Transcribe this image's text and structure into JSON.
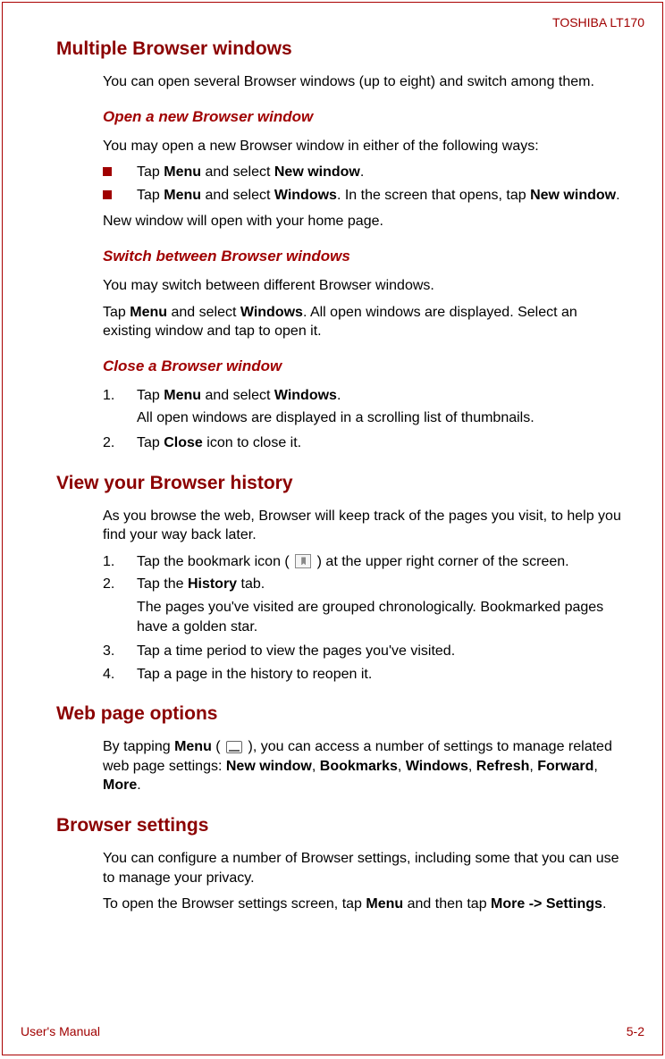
{
  "header": {
    "model": "TOSHIBA LT170"
  },
  "footer": {
    "left": "User's Manual",
    "right": "5-2"
  },
  "s1": {
    "title": "Multiple Browser windows",
    "intro": "You can open several Browser windows (up to eight) and switch among them.",
    "sub1": {
      "title": "Open a new Browser window",
      "p1": "You may open a new Browser window in either of the following ways:",
      "b1_pre": "Tap ",
      "b1_bold1": "Menu",
      "b1_mid": " and select ",
      "b1_bold2": "New window",
      "b1_post": ".",
      "b2_pre": "Tap ",
      "b2_bold1": "Menu",
      "b2_mid": " and select ",
      "b2_bold2": "Windows",
      "b2_mid2": ". In the screen that opens, tap ",
      "b2_bold3": "New window",
      "b2_post": ".",
      "p2": "New window will open with your home page."
    },
    "sub2": {
      "title": "Switch between Browser windows",
      "p1": "You may switch between different Browser windows.",
      "p2_pre": "Tap ",
      "p2_bold1": "Menu",
      "p2_mid": " and select ",
      "p2_bold2": "Windows",
      "p2_post": ". All open windows are displayed. Select an existing window and tap to open it."
    },
    "sub3": {
      "title": "Close a Browser window",
      "n1": "1.",
      "n1_pre": "Tap ",
      "n1_bold1": "Menu",
      "n1_mid": " and select ",
      "n1_bold2": "Windows",
      "n1_post": ".",
      "n1_sub": "All open windows are displayed in a scrolling list of thumbnails.",
      "n2": "2.",
      "n2_pre": "Tap ",
      "n2_bold1": "Close",
      "n2_post": " icon to close it."
    }
  },
  "s2": {
    "title": "View your Browser history",
    "intro": "As you browse the web, Browser will keep track of the pages you visit, to help you find your way back later.",
    "n1": "1.",
    "n1_pre": "Tap the bookmark icon ( ",
    "n1_post": " ) at the upper right corner of the screen.",
    "n2": "2.",
    "n2_pre": "Tap the ",
    "n2_bold1": "History",
    "n2_post": " tab.",
    "n2_sub": "The pages you've visited are grouped chronologically. Bookmarked pages have a golden star.",
    "n3": "3.",
    "n3_text": "Tap a time period to view the pages you've visited.",
    "n4": "4.",
    "n4_text": "Tap a page in the history to reopen it."
  },
  "s3": {
    "title": "Web page options",
    "p_pre": "By tapping ",
    "p_bold1": "Menu",
    "p_mid1": " ( ",
    "p_mid2": " ), you can access a number of settings to manage related web page settings: ",
    "p_bold2": "New window",
    "p_c1": ", ",
    "p_bold3": "Bookmarks",
    "p_c2": ", ",
    "p_bold4": "Windows",
    "p_c3": ", ",
    "p_bold5": "Refresh",
    "p_c4": ", ",
    "p_bold6": "Forward",
    "p_c5": ", ",
    "p_bold7": "More",
    "p_post": "."
  },
  "s4": {
    "title": "Browser settings",
    "p1": "You can configure a number of Browser settings, including some that you can use to manage your privacy.",
    "p2_pre": "To open the Browser settings screen, tap ",
    "p2_bold1": "Menu",
    "p2_mid": " and then tap ",
    "p2_bold2": "More -> Settings",
    "p2_post": "."
  }
}
